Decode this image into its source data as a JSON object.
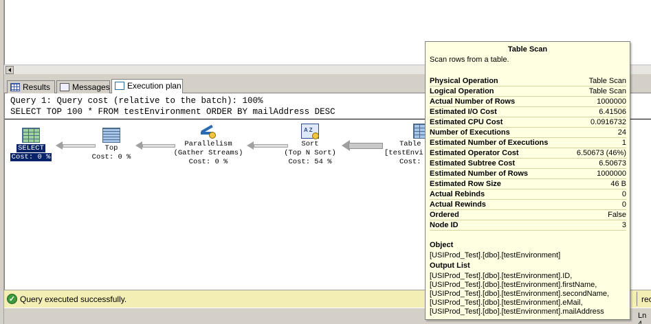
{
  "tabs": [
    {
      "label": "Results",
      "icon": "grid-icon"
    },
    {
      "label": "Messages",
      "icon": "messages-icon"
    },
    {
      "label": "Execution plan",
      "icon": "execution-plan-icon"
    }
  ],
  "plan": {
    "query_line": "Query 1: Query cost (relative to the batch): 100%",
    "sql_line": "SELECT TOP 100 * FROM testEnvironment ORDER BY mailAddress DESC",
    "nodes": [
      {
        "label": "SELECT",
        "sub": "",
        "cost": "Cost: 0 %",
        "icon": "select-icon"
      },
      {
        "label": "Top",
        "sub": "",
        "cost": "Cost: 0 %",
        "icon": "top-icon"
      },
      {
        "label": "Parallelism",
        "sub": "(Gather Streams)",
        "cost": "Cost: 0 %",
        "icon": "parallelism-icon"
      },
      {
        "label": "Sort",
        "sub": "(Top N Sort)",
        "cost": "Cost: 54 %",
        "icon": "sort-icon"
      },
      {
        "label": "Table",
        "sub": "[testEnvi",
        "cost": "Cost:",
        "icon": "table-scan-icon"
      }
    ]
  },
  "tooltip": {
    "title": "Table Scan",
    "description": "Scan rows from a table.",
    "properties": [
      {
        "name": "Physical Operation",
        "value": "Table Scan"
      },
      {
        "name": "Logical Operation",
        "value": "Table Scan"
      },
      {
        "name": "Actual Number of Rows",
        "value": "1000000"
      },
      {
        "name": "Estimated I/O Cost",
        "value": "6.41506"
      },
      {
        "name": "Estimated CPU Cost",
        "value": "0.0916732"
      },
      {
        "name": "Number of Executions",
        "value": "24"
      },
      {
        "name": "Estimated Number of Executions",
        "value": "1"
      },
      {
        "name": "Estimated Operator Cost",
        "value": "6.50673 (46%)"
      },
      {
        "name": "Estimated Subtree Cost",
        "value": "6.50673"
      },
      {
        "name": "Estimated Number of Rows",
        "value": "1000000"
      },
      {
        "name": "Estimated Row Size",
        "value": "46 B"
      },
      {
        "name": "Actual Rebinds",
        "value": "0"
      },
      {
        "name": "Actual Rewinds",
        "value": "0"
      },
      {
        "name": "Ordered",
        "value": "False"
      },
      {
        "name": "Node ID",
        "value": "3"
      }
    ],
    "object_heading": "Object",
    "object_value": "[USIProd_Test].[dbo].[testEnvironment]",
    "output_heading": "Output List",
    "output_list": [
      "[USIProd_Test].[dbo].[testEnvironment].ID,",
      "[USIProd_Test].[dbo].[testEnvironment].firstName,",
      "[USIProd_Test].[dbo].[testEnvironment].secondName,",
      "[USIProd_Test].[dbo].[testEnvironment].eMail,",
      "[USIProd_Test].[dbo].[testEnvironment].mailAddress"
    ]
  },
  "status": {
    "message": "Query executed successfully.",
    "seg1": ")",
    "seg2": "rec",
    "line": "Ln 4"
  },
  "colors": {
    "selection": "#0a246a",
    "status_bg": "#f3efb4",
    "tooltip_bg": "#ffffe1"
  }
}
